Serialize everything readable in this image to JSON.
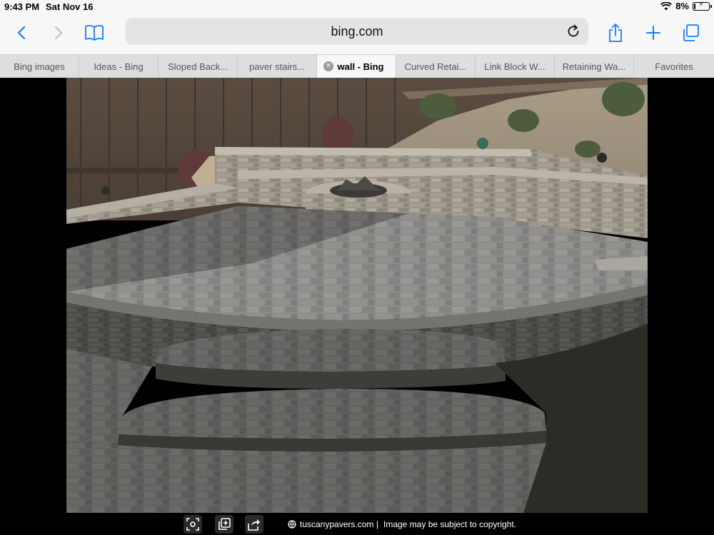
{
  "status": {
    "time": "9:43 PM",
    "date": "Sat Nov 16",
    "battery_percent": "8%",
    "battery_level": 0.08
  },
  "toolbar": {
    "url": "bing.com",
    "icons": [
      "back-icon",
      "forward-icon",
      "bookmarks-icon",
      "reload-icon",
      "share-icon",
      "new-tab-icon",
      "tabs-overview-icon"
    ],
    "accent_color": "#1a7cf5"
  },
  "tabs": [
    {
      "label": "Bing images",
      "active": false
    },
    {
      "label": "Ideas - Bing",
      "active": false
    },
    {
      "label": "Sloped Back...",
      "active": false
    },
    {
      "label": "paver stairs...",
      "active": false
    },
    {
      "label": "wall - Bing",
      "active": true
    },
    {
      "label": "Curved Retai...",
      "active": false
    },
    {
      "label": "Link Block W...",
      "active": false
    },
    {
      "label": "Retaining Wa...",
      "active": false
    },
    {
      "label": "Favorites",
      "active": false
    }
  ],
  "image_viewer": {
    "source": "tuscanypavers.com",
    "separator": "|",
    "copyright": "Image may be subject to copyright."
  }
}
